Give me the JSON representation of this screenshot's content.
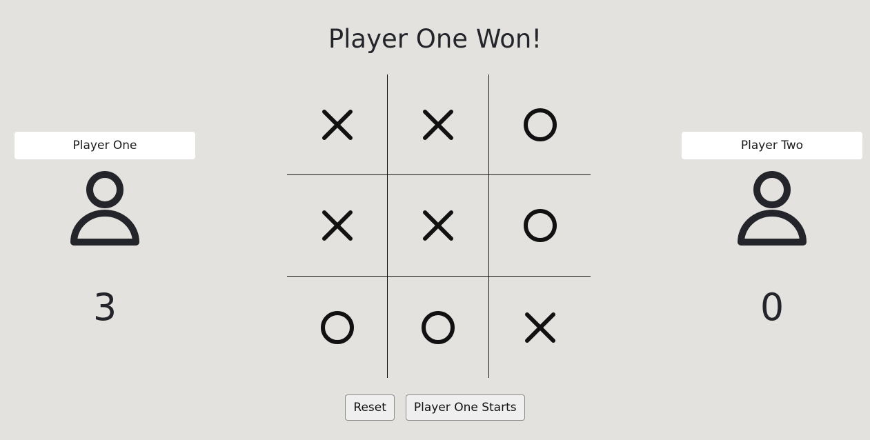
{
  "status_message": "Player One Won!",
  "players": [
    {
      "name": "Player One",
      "score": "3",
      "icon": "user-icon"
    },
    {
      "name": "Player Two",
      "score": "0",
      "icon": "user-icon"
    }
  ],
  "board": {
    "cells": [
      "X",
      "X",
      "O",
      "X",
      "X",
      "O",
      "O",
      "O",
      "X"
    ]
  },
  "controls": {
    "reset_label": "Reset",
    "starter_label": "Player One Starts"
  }
}
